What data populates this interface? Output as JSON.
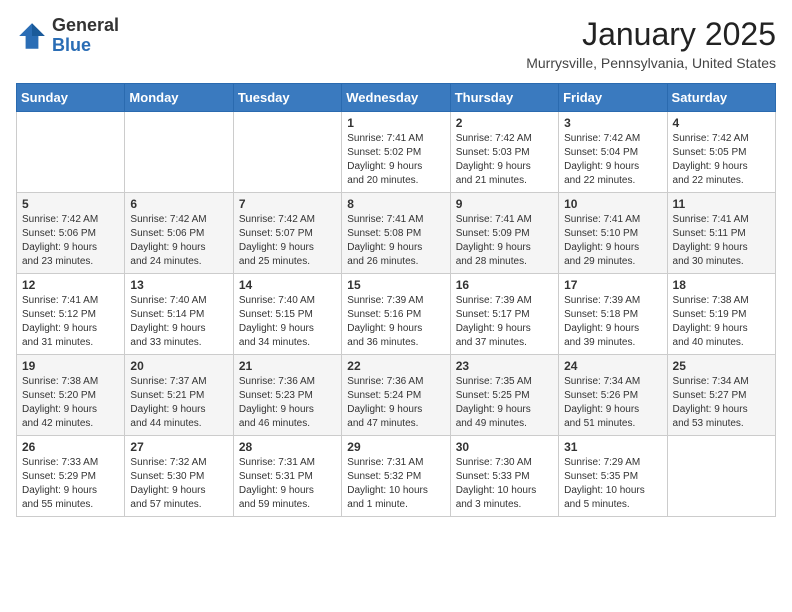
{
  "header": {
    "logo_general": "General",
    "logo_blue": "Blue",
    "month_title": "January 2025",
    "location": "Murrysville, Pennsylvania, United States"
  },
  "days_of_week": [
    "Sunday",
    "Monday",
    "Tuesday",
    "Wednesday",
    "Thursday",
    "Friday",
    "Saturday"
  ],
  "weeks": [
    [
      {
        "day": "",
        "info": ""
      },
      {
        "day": "",
        "info": ""
      },
      {
        "day": "",
        "info": ""
      },
      {
        "day": "1",
        "info": "Sunrise: 7:41 AM\nSunset: 5:02 PM\nDaylight: 9 hours\nand 20 minutes."
      },
      {
        "day": "2",
        "info": "Sunrise: 7:42 AM\nSunset: 5:03 PM\nDaylight: 9 hours\nand 21 minutes."
      },
      {
        "day": "3",
        "info": "Sunrise: 7:42 AM\nSunset: 5:04 PM\nDaylight: 9 hours\nand 22 minutes."
      },
      {
        "day": "4",
        "info": "Sunrise: 7:42 AM\nSunset: 5:05 PM\nDaylight: 9 hours\nand 22 minutes."
      }
    ],
    [
      {
        "day": "5",
        "info": "Sunrise: 7:42 AM\nSunset: 5:06 PM\nDaylight: 9 hours\nand 23 minutes."
      },
      {
        "day": "6",
        "info": "Sunrise: 7:42 AM\nSunset: 5:06 PM\nDaylight: 9 hours\nand 24 minutes."
      },
      {
        "day": "7",
        "info": "Sunrise: 7:42 AM\nSunset: 5:07 PM\nDaylight: 9 hours\nand 25 minutes."
      },
      {
        "day": "8",
        "info": "Sunrise: 7:41 AM\nSunset: 5:08 PM\nDaylight: 9 hours\nand 26 minutes."
      },
      {
        "day": "9",
        "info": "Sunrise: 7:41 AM\nSunset: 5:09 PM\nDaylight: 9 hours\nand 28 minutes."
      },
      {
        "day": "10",
        "info": "Sunrise: 7:41 AM\nSunset: 5:10 PM\nDaylight: 9 hours\nand 29 minutes."
      },
      {
        "day": "11",
        "info": "Sunrise: 7:41 AM\nSunset: 5:11 PM\nDaylight: 9 hours\nand 30 minutes."
      }
    ],
    [
      {
        "day": "12",
        "info": "Sunrise: 7:41 AM\nSunset: 5:12 PM\nDaylight: 9 hours\nand 31 minutes."
      },
      {
        "day": "13",
        "info": "Sunrise: 7:40 AM\nSunset: 5:14 PM\nDaylight: 9 hours\nand 33 minutes."
      },
      {
        "day": "14",
        "info": "Sunrise: 7:40 AM\nSunset: 5:15 PM\nDaylight: 9 hours\nand 34 minutes."
      },
      {
        "day": "15",
        "info": "Sunrise: 7:39 AM\nSunset: 5:16 PM\nDaylight: 9 hours\nand 36 minutes."
      },
      {
        "day": "16",
        "info": "Sunrise: 7:39 AM\nSunset: 5:17 PM\nDaylight: 9 hours\nand 37 minutes."
      },
      {
        "day": "17",
        "info": "Sunrise: 7:39 AM\nSunset: 5:18 PM\nDaylight: 9 hours\nand 39 minutes."
      },
      {
        "day": "18",
        "info": "Sunrise: 7:38 AM\nSunset: 5:19 PM\nDaylight: 9 hours\nand 40 minutes."
      }
    ],
    [
      {
        "day": "19",
        "info": "Sunrise: 7:38 AM\nSunset: 5:20 PM\nDaylight: 9 hours\nand 42 minutes."
      },
      {
        "day": "20",
        "info": "Sunrise: 7:37 AM\nSunset: 5:21 PM\nDaylight: 9 hours\nand 44 minutes."
      },
      {
        "day": "21",
        "info": "Sunrise: 7:36 AM\nSunset: 5:23 PM\nDaylight: 9 hours\nand 46 minutes."
      },
      {
        "day": "22",
        "info": "Sunrise: 7:36 AM\nSunset: 5:24 PM\nDaylight: 9 hours\nand 47 minutes."
      },
      {
        "day": "23",
        "info": "Sunrise: 7:35 AM\nSunset: 5:25 PM\nDaylight: 9 hours\nand 49 minutes."
      },
      {
        "day": "24",
        "info": "Sunrise: 7:34 AM\nSunset: 5:26 PM\nDaylight: 9 hours\nand 51 minutes."
      },
      {
        "day": "25",
        "info": "Sunrise: 7:34 AM\nSunset: 5:27 PM\nDaylight: 9 hours\nand 53 minutes."
      }
    ],
    [
      {
        "day": "26",
        "info": "Sunrise: 7:33 AM\nSunset: 5:29 PM\nDaylight: 9 hours\nand 55 minutes."
      },
      {
        "day": "27",
        "info": "Sunrise: 7:32 AM\nSunset: 5:30 PM\nDaylight: 9 hours\nand 57 minutes."
      },
      {
        "day": "28",
        "info": "Sunrise: 7:31 AM\nSunset: 5:31 PM\nDaylight: 9 hours\nand 59 minutes."
      },
      {
        "day": "29",
        "info": "Sunrise: 7:31 AM\nSunset: 5:32 PM\nDaylight: 10 hours\nand 1 minute."
      },
      {
        "day": "30",
        "info": "Sunrise: 7:30 AM\nSunset: 5:33 PM\nDaylight: 10 hours\nand 3 minutes."
      },
      {
        "day": "31",
        "info": "Sunrise: 7:29 AM\nSunset: 5:35 PM\nDaylight: 10 hours\nand 5 minutes."
      },
      {
        "day": "",
        "info": ""
      }
    ]
  ]
}
